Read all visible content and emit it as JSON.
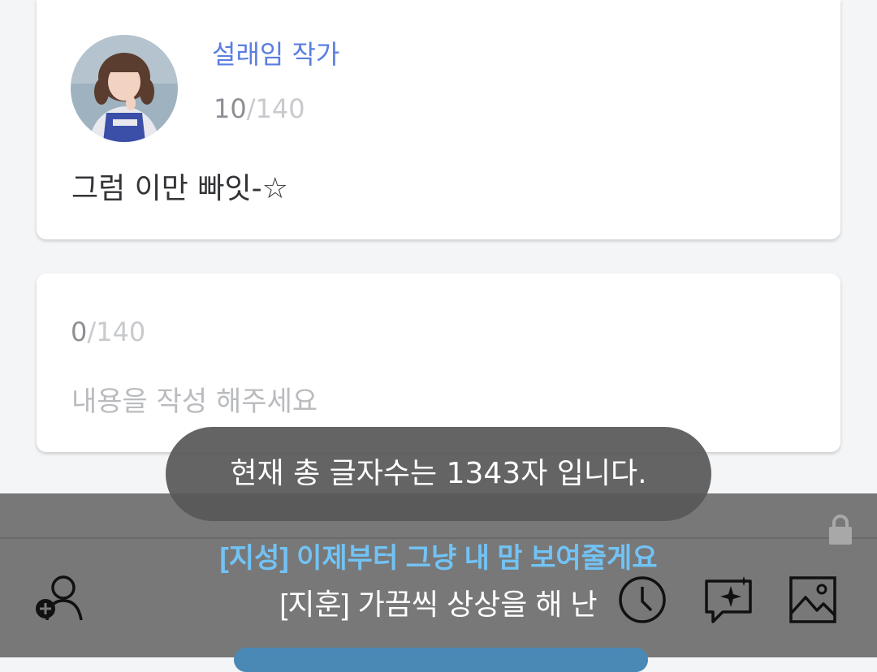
{
  "post": {
    "author": "설래임 작가",
    "char_count": "10",
    "char_max": "/140",
    "text": "그럼 이만 빠잇-☆"
  },
  "compose": {
    "char_count": "0",
    "char_max": "/140",
    "placeholder": "내용을 작성 해주세요"
  },
  "toast": {
    "message": "현재 총 글자수는 1343자 입니다."
  },
  "lyrics": {
    "line1": "[지성] 이제부터 그냥 내 맘 보여줄게요",
    "line2": "[지훈] 가끔씩 상상을 해 난"
  },
  "toolbar": {
    "icons": [
      "add-user-icon",
      "clock-icon",
      "sticker-icon",
      "image-icon",
      "lock-icon"
    ]
  },
  "colors": {
    "author": "#5b7de0",
    "lyric_highlight": "#72c3f5",
    "bar": "#787878"
  }
}
